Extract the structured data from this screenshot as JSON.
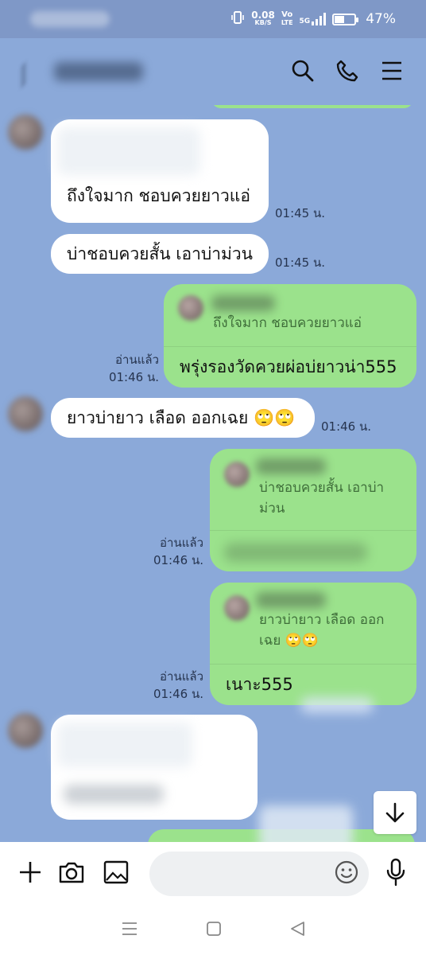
{
  "status_bar": {
    "net_speed_value": "0.08",
    "net_speed_unit": "KB/S",
    "volte_top": "Vo",
    "volte_bottom": "LTE",
    "network": "5G",
    "battery": "47%"
  },
  "header": {
    "icons": [
      "search-icon",
      "phone-icon",
      "menu-icon"
    ]
  },
  "messages": [
    {
      "dir": "in",
      "text": "ถึงใจมาก ชอบควยยาวแอ่",
      "time": "01:45 น."
    },
    {
      "dir": "in",
      "text": "บ่าชอบควยสั้น เอาบ่าม่วน",
      "time": "01:45 น."
    },
    {
      "dir": "out",
      "quote": "ถึงใจมาก ชอบควยยาวแอ่",
      "text": "พรุ่งรองวัดควยผ่อบ่ยาวน่า555",
      "read": "อ่านแล้ว",
      "time": "01:46 น."
    },
    {
      "dir": "in",
      "text": "ยาวบ่ายาว เลือด ออกเฉย 🙄🙄",
      "time": "01:46 น."
    },
    {
      "dir": "out",
      "quote_line1": "บ่าชอบควยสั้น เอาบ่า",
      "quote_line2": "ม่วน",
      "read": "อ่านแล้ว",
      "time": "01:46 น."
    },
    {
      "dir": "out",
      "quote_line1": "ยาวบ่ายาว เลือด ออก",
      "quote_line2": "เฉย 🙄🙄",
      "text": "เนาะ555",
      "read": "อ่านแล้ว",
      "time": "01:46 น."
    }
  ],
  "composer": {
    "placeholder": "",
    "icons": [
      "plus-icon",
      "camera-icon",
      "image-icon",
      "emoji-icon",
      "microphone-icon"
    ]
  },
  "colors": {
    "background": "#8ba9d9",
    "incoming_bubble": "#ffffff",
    "outgoing_bubble": "#9be28c"
  }
}
